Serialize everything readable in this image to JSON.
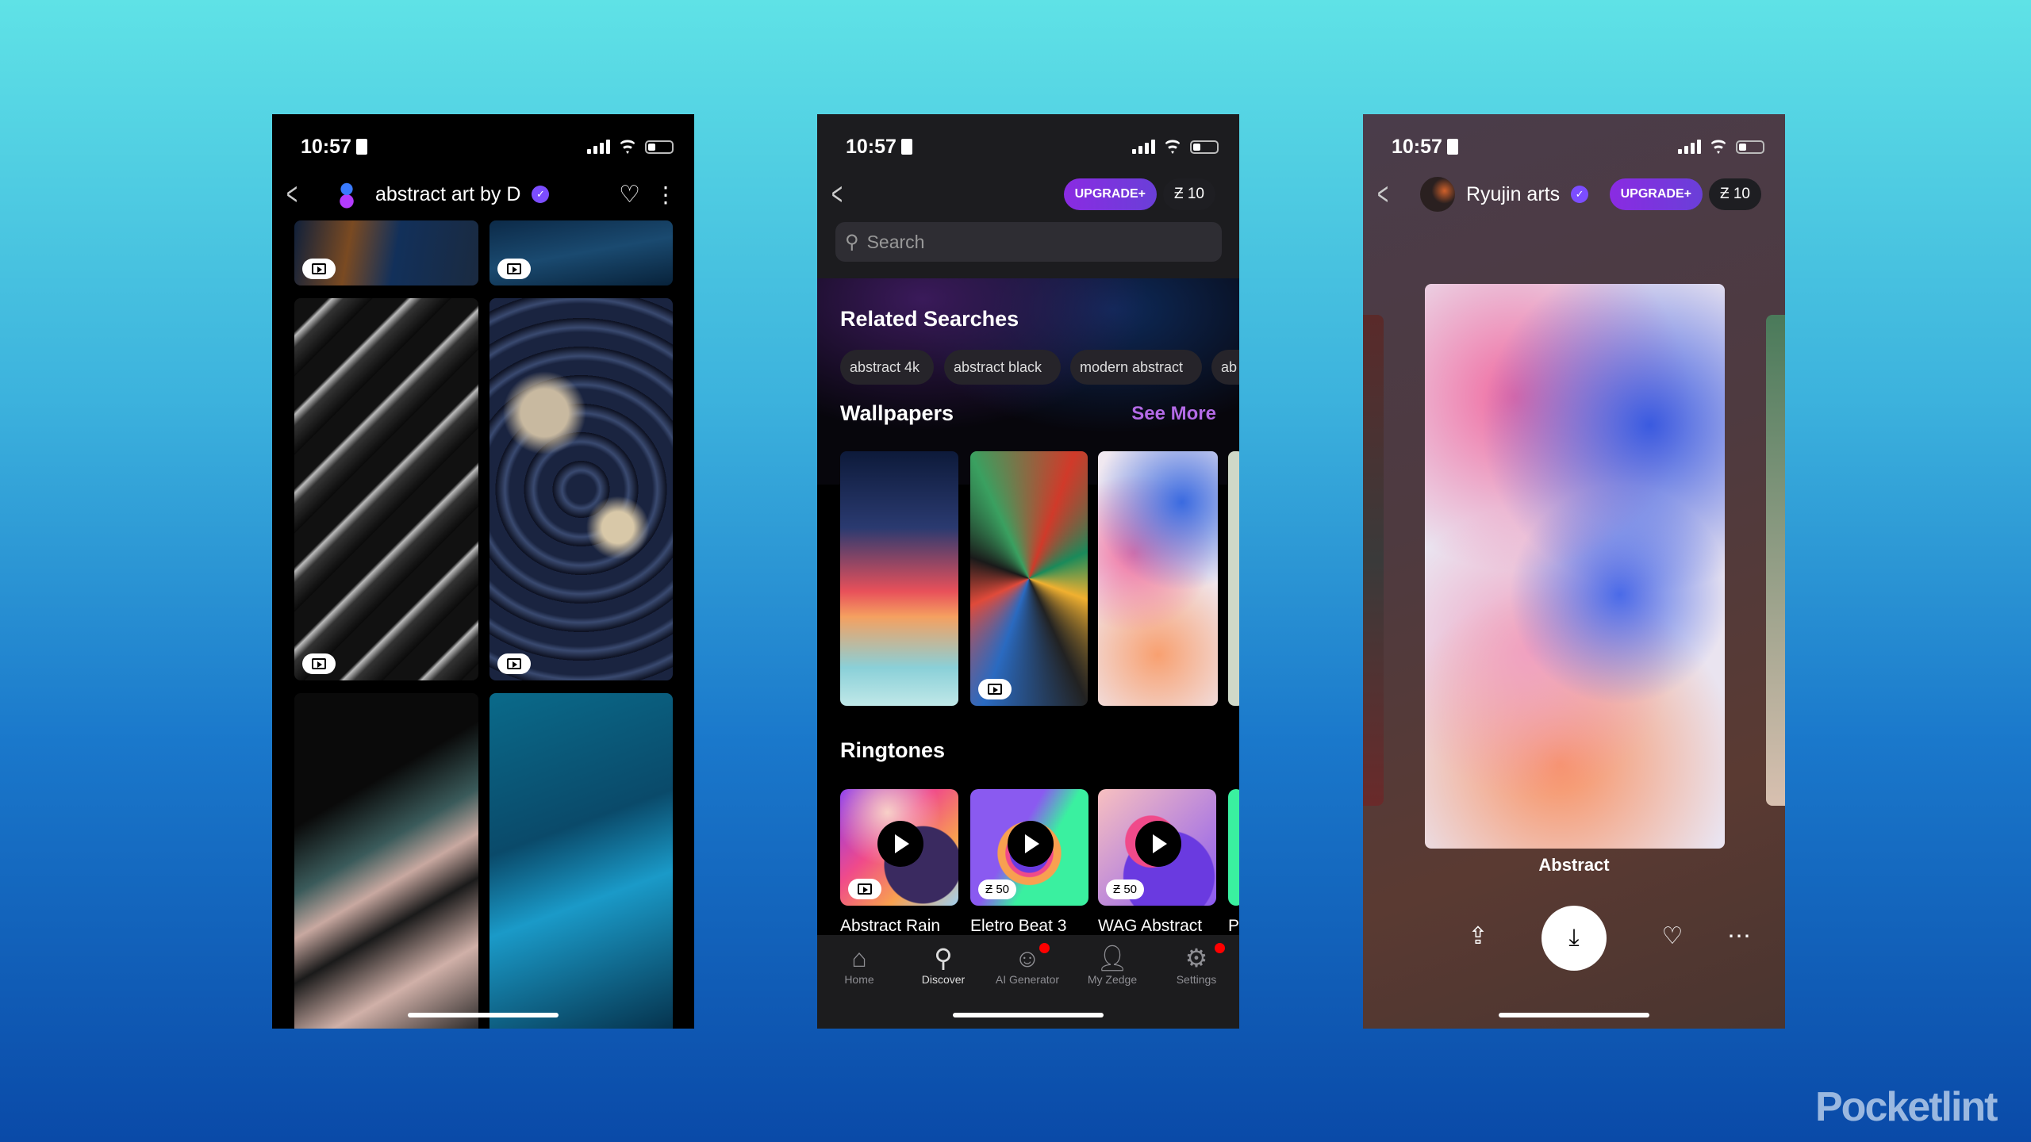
{
  "status": {
    "time": "10:57"
  },
  "screen1": {
    "creator": "abstract art by D"
  },
  "screen2": {
    "upgrade": "UPGRADE+",
    "coins": "Ƶ 10",
    "search_placeholder": "Search",
    "related_title": "Related Searches",
    "chips": [
      "abstract 4k",
      "abstract black",
      "modern abstract",
      "ab"
    ],
    "wallpapers_title": "Wallpapers",
    "see_more": "See More",
    "ringtones_title": "Ringtones",
    "ringtones": [
      {
        "name": "Abstract Rain",
        "price": ""
      },
      {
        "name": "Eletro Beat 3",
        "price": "Ƶ 50"
      },
      {
        "name": "WAG Abstract",
        "price": "Ƶ 50"
      },
      {
        "name": "P",
        "price": ""
      }
    ],
    "tabs": [
      "Home",
      "Discover",
      "AI Generator",
      "My Zedge",
      "Settings"
    ],
    "active_tab": "Discover"
  },
  "screen3": {
    "creator": "Ryujin arts",
    "upgrade": "UPGRADE+",
    "coins": "Ƶ 10",
    "title": "Abstract"
  },
  "watermark": "Pocketlint",
  "colors": {
    "accent": "#7c3fe0",
    "see_more": "#b36ae6",
    "notification": "#ff0000"
  }
}
